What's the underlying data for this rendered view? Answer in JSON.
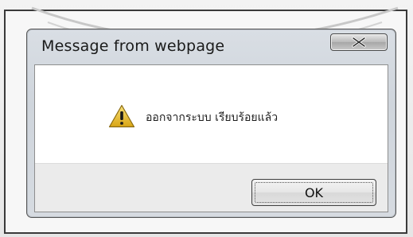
{
  "dialog": {
    "title": "Message from webpage",
    "close_icon": "close-x-icon",
    "message_icon": "warning-icon",
    "message": "ออกจากระบบ เรียบร้อยแล้ว",
    "ok_label": "OK"
  },
  "colors": {
    "warning_fill": "#f2c230",
    "close_button": "#b5b5b5"
  }
}
